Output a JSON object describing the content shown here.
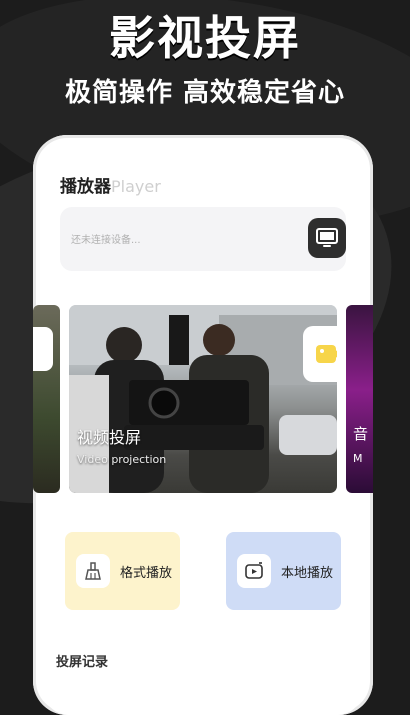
{
  "banner": {
    "headline": "影视投屏",
    "tagline": "极简操作 高效稳定省心"
  },
  "header": {
    "title_zh": "播放器",
    "title_en": "Player"
  },
  "search": {
    "placeholder": "还未连接设备..."
  },
  "carousel": {
    "main": {
      "label": "视频投屏",
      "sub": "Video projection"
    },
    "next": {
      "label": "音",
      "sub": "M"
    }
  },
  "features": [
    {
      "label": "格式播放"
    },
    {
      "label": "本地播放"
    }
  ],
  "history": {
    "title": "投屏记录"
  },
  "colors": {
    "accent_yellow": "#f7d54a",
    "tile_yellow": "#fdf3cc",
    "tile_blue": "#cfdcf6",
    "dark": "#2e2e2e"
  },
  "icons": [
    "tv-cast-icon",
    "video-camera-icon",
    "broom-icon",
    "play-file-icon"
  ]
}
